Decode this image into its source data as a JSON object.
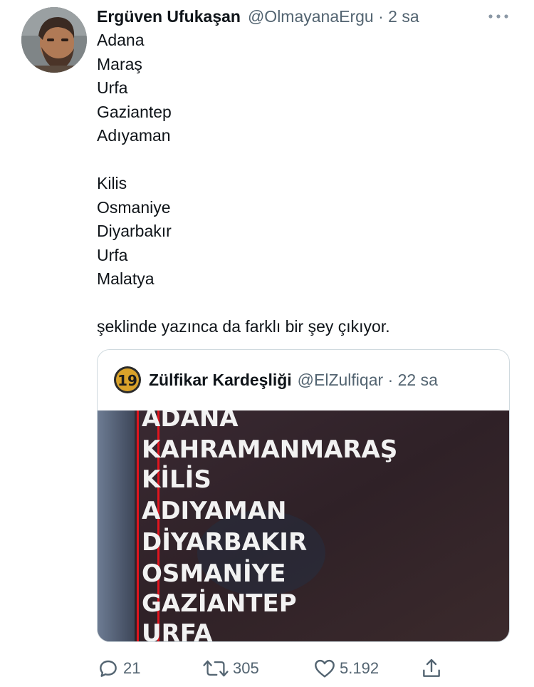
{
  "author": {
    "name": "Ergüven Ufukaşan",
    "handle": "@OlmayanaErgu",
    "time": "· 2 sa"
  },
  "tweet": {
    "lines": [
      "Adana",
      "Maraş",
      "Urfa",
      "Gaziantep",
      "Adıyaman",
      "",
      "Kilis",
      "Osmaniye",
      "Diyarbakır",
      "Urfa",
      "Malatya",
      "",
      "şeklinde yazınca da farklı bir şey çıkıyor."
    ]
  },
  "quoted": {
    "name": "Zülfikar Kardeşliği",
    "handle": "@ElZulfiqar",
    "time": "· 22 sa",
    "avatar_text": "19",
    "image_list": [
      "ADANA",
      "KAHRAMANMARAŞ",
      "KİLİS",
      "ADIYAMAN",
      "DİYARBAKIR",
      "OSMANİYE",
      "GAZİANTEP",
      "URFA"
    ]
  },
  "actions": {
    "reply_count": "21",
    "retweet_count": "305",
    "like_count": "5.192"
  },
  "icons": {
    "more": "more-dots-icon",
    "reply": "reply-icon",
    "retweet": "retweet-icon",
    "like": "heart-icon",
    "share": "share-icon"
  },
  "colors": {
    "text": "#0f1419",
    "secondary": "#536471",
    "border": "#cfd9de",
    "image_bg": "#2e1f24",
    "red_line": "#e0151f"
  }
}
